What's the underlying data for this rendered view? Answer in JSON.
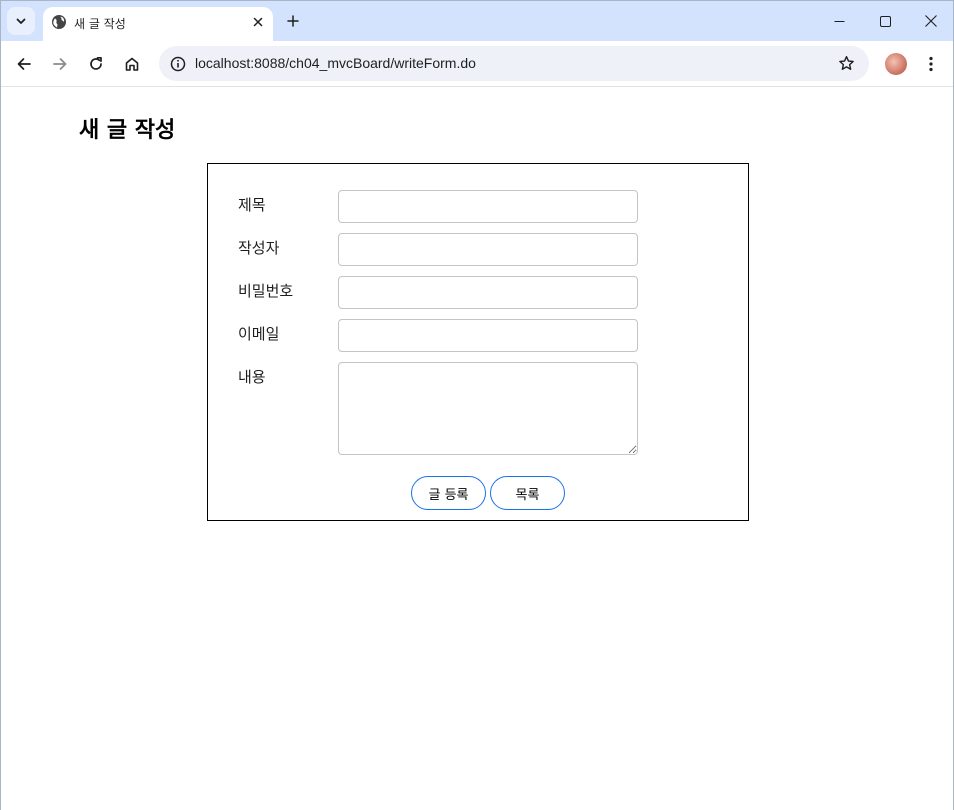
{
  "browser": {
    "tab_title": "새 글 작성",
    "url": "localhost:8088/ch04_mvcBoard/writeForm.do"
  },
  "page": {
    "title": "새 글 작성",
    "fields": [
      {
        "label": "제목",
        "value": ""
      },
      {
        "label": "작성자",
        "value": ""
      },
      {
        "label": "비밀번호",
        "value": ""
      },
      {
        "label": "이메일",
        "value": ""
      },
      {
        "label": "내용",
        "value": ""
      }
    ],
    "buttons": {
      "submit": "글 등록",
      "list": "목록"
    }
  }
}
